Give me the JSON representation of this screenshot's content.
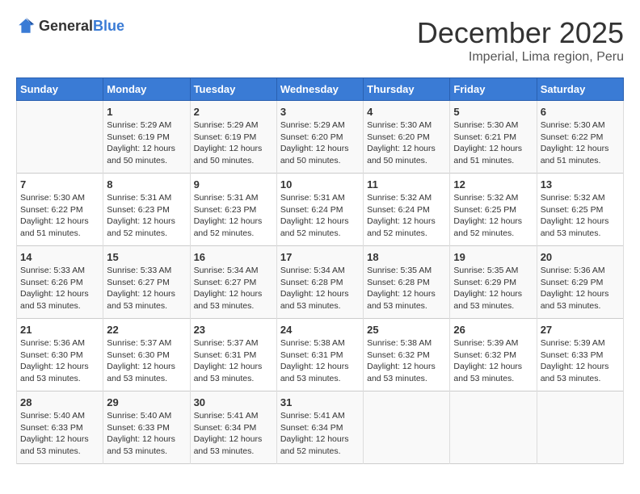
{
  "logo": {
    "general": "General",
    "blue": "Blue"
  },
  "header": {
    "month": "December 2025",
    "location": "Imperial, Lima region, Peru"
  },
  "weekdays": [
    "Sunday",
    "Monday",
    "Tuesday",
    "Wednesday",
    "Thursday",
    "Friday",
    "Saturday"
  ],
  "weeks": [
    [
      {
        "day": "",
        "info": ""
      },
      {
        "day": "1",
        "info": "Sunrise: 5:29 AM\nSunset: 6:19 PM\nDaylight: 12 hours\nand 50 minutes."
      },
      {
        "day": "2",
        "info": "Sunrise: 5:29 AM\nSunset: 6:19 PM\nDaylight: 12 hours\nand 50 minutes."
      },
      {
        "day": "3",
        "info": "Sunrise: 5:29 AM\nSunset: 6:20 PM\nDaylight: 12 hours\nand 50 minutes."
      },
      {
        "day": "4",
        "info": "Sunrise: 5:30 AM\nSunset: 6:20 PM\nDaylight: 12 hours\nand 50 minutes."
      },
      {
        "day": "5",
        "info": "Sunrise: 5:30 AM\nSunset: 6:21 PM\nDaylight: 12 hours\nand 51 minutes."
      },
      {
        "day": "6",
        "info": "Sunrise: 5:30 AM\nSunset: 6:22 PM\nDaylight: 12 hours\nand 51 minutes."
      }
    ],
    [
      {
        "day": "7",
        "info": "Sunrise: 5:30 AM\nSunset: 6:22 PM\nDaylight: 12 hours\nand 51 minutes."
      },
      {
        "day": "8",
        "info": "Sunrise: 5:31 AM\nSunset: 6:23 PM\nDaylight: 12 hours\nand 52 minutes."
      },
      {
        "day": "9",
        "info": "Sunrise: 5:31 AM\nSunset: 6:23 PM\nDaylight: 12 hours\nand 52 minutes."
      },
      {
        "day": "10",
        "info": "Sunrise: 5:31 AM\nSunset: 6:24 PM\nDaylight: 12 hours\nand 52 minutes."
      },
      {
        "day": "11",
        "info": "Sunrise: 5:32 AM\nSunset: 6:24 PM\nDaylight: 12 hours\nand 52 minutes."
      },
      {
        "day": "12",
        "info": "Sunrise: 5:32 AM\nSunset: 6:25 PM\nDaylight: 12 hours\nand 52 minutes."
      },
      {
        "day": "13",
        "info": "Sunrise: 5:32 AM\nSunset: 6:25 PM\nDaylight: 12 hours\nand 53 minutes."
      }
    ],
    [
      {
        "day": "14",
        "info": "Sunrise: 5:33 AM\nSunset: 6:26 PM\nDaylight: 12 hours\nand 53 minutes."
      },
      {
        "day": "15",
        "info": "Sunrise: 5:33 AM\nSunset: 6:27 PM\nDaylight: 12 hours\nand 53 minutes."
      },
      {
        "day": "16",
        "info": "Sunrise: 5:34 AM\nSunset: 6:27 PM\nDaylight: 12 hours\nand 53 minutes."
      },
      {
        "day": "17",
        "info": "Sunrise: 5:34 AM\nSunset: 6:28 PM\nDaylight: 12 hours\nand 53 minutes."
      },
      {
        "day": "18",
        "info": "Sunrise: 5:35 AM\nSunset: 6:28 PM\nDaylight: 12 hours\nand 53 minutes."
      },
      {
        "day": "19",
        "info": "Sunrise: 5:35 AM\nSunset: 6:29 PM\nDaylight: 12 hours\nand 53 minutes."
      },
      {
        "day": "20",
        "info": "Sunrise: 5:36 AM\nSunset: 6:29 PM\nDaylight: 12 hours\nand 53 minutes."
      }
    ],
    [
      {
        "day": "21",
        "info": "Sunrise: 5:36 AM\nSunset: 6:30 PM\nDaylight: 12 hours\nand 53 minutes."
      },
      {
        "day": "22",
        "info": "Sunrise: 5:37 AM\nSunset: 6:30 PM\nDaylight: 12 hours\nand 53 minutes."
      },
      {
        "day": "23",
        "info": "Sunrise: 5:37 AM\nSunset: 6:31 PM\nDaylight: 12 hours\nand 53 minutes."
      },
      {
        "day": "24",
        "info": "Sunrise: 5:38 AM\nSunset: 6:31 PM\nDaylight: 12 hours\nand 53 minutes."
      },
      {
        "day": "25",
        "info": "Sunrise: 5:38 AM\nSunset: 6:32 PM\nDaylight: 12 hours\nand 53 minutes."
      },
      {
        "day": "26",
        "info": "Sunrise: 5:39 AM\nSunset: 6:32 PM\nDaylight: 12 hours\nand 53 minutes."
      },
      {
        "day": "27",
        "info": "Sunrise: 5:39 AM\nSunset: 6:33 PM\nDaylight: 12 hours\nand 53 minutes."
      }
    ],
    [
      {
        "day": "28",
        "info": "Sunrise: 5:40 AM\nSunset: 6:33 PM\nDaylight: 12 hours\nand 53 minutes."
      },
      {
        "day": "29",
        "info": "Sunrise: 5:40 AM\nSunset: 6:33 PM\nDaylight: 12 hours\nand 53 minutes."
      },
      {
        "day": "30",
        "info": "Sunrise: 5:41 AM\nSunset: 6:34 PM\nDaylight: 12 hours\nand 53 minutes."
      },
      {
        "day": "31",
        "info": "Sunrise: 5:41 AM\nSunset: 6:34 PM\nDaylight: 12 hours\nand 52 minutes."
      },
      {
        "day": "",
        "info": ""
      },
      {
        "day": "",
        "info": ""
      },
      {
        "day": "",
        "info": ""
      }
    ]
  ]
}
